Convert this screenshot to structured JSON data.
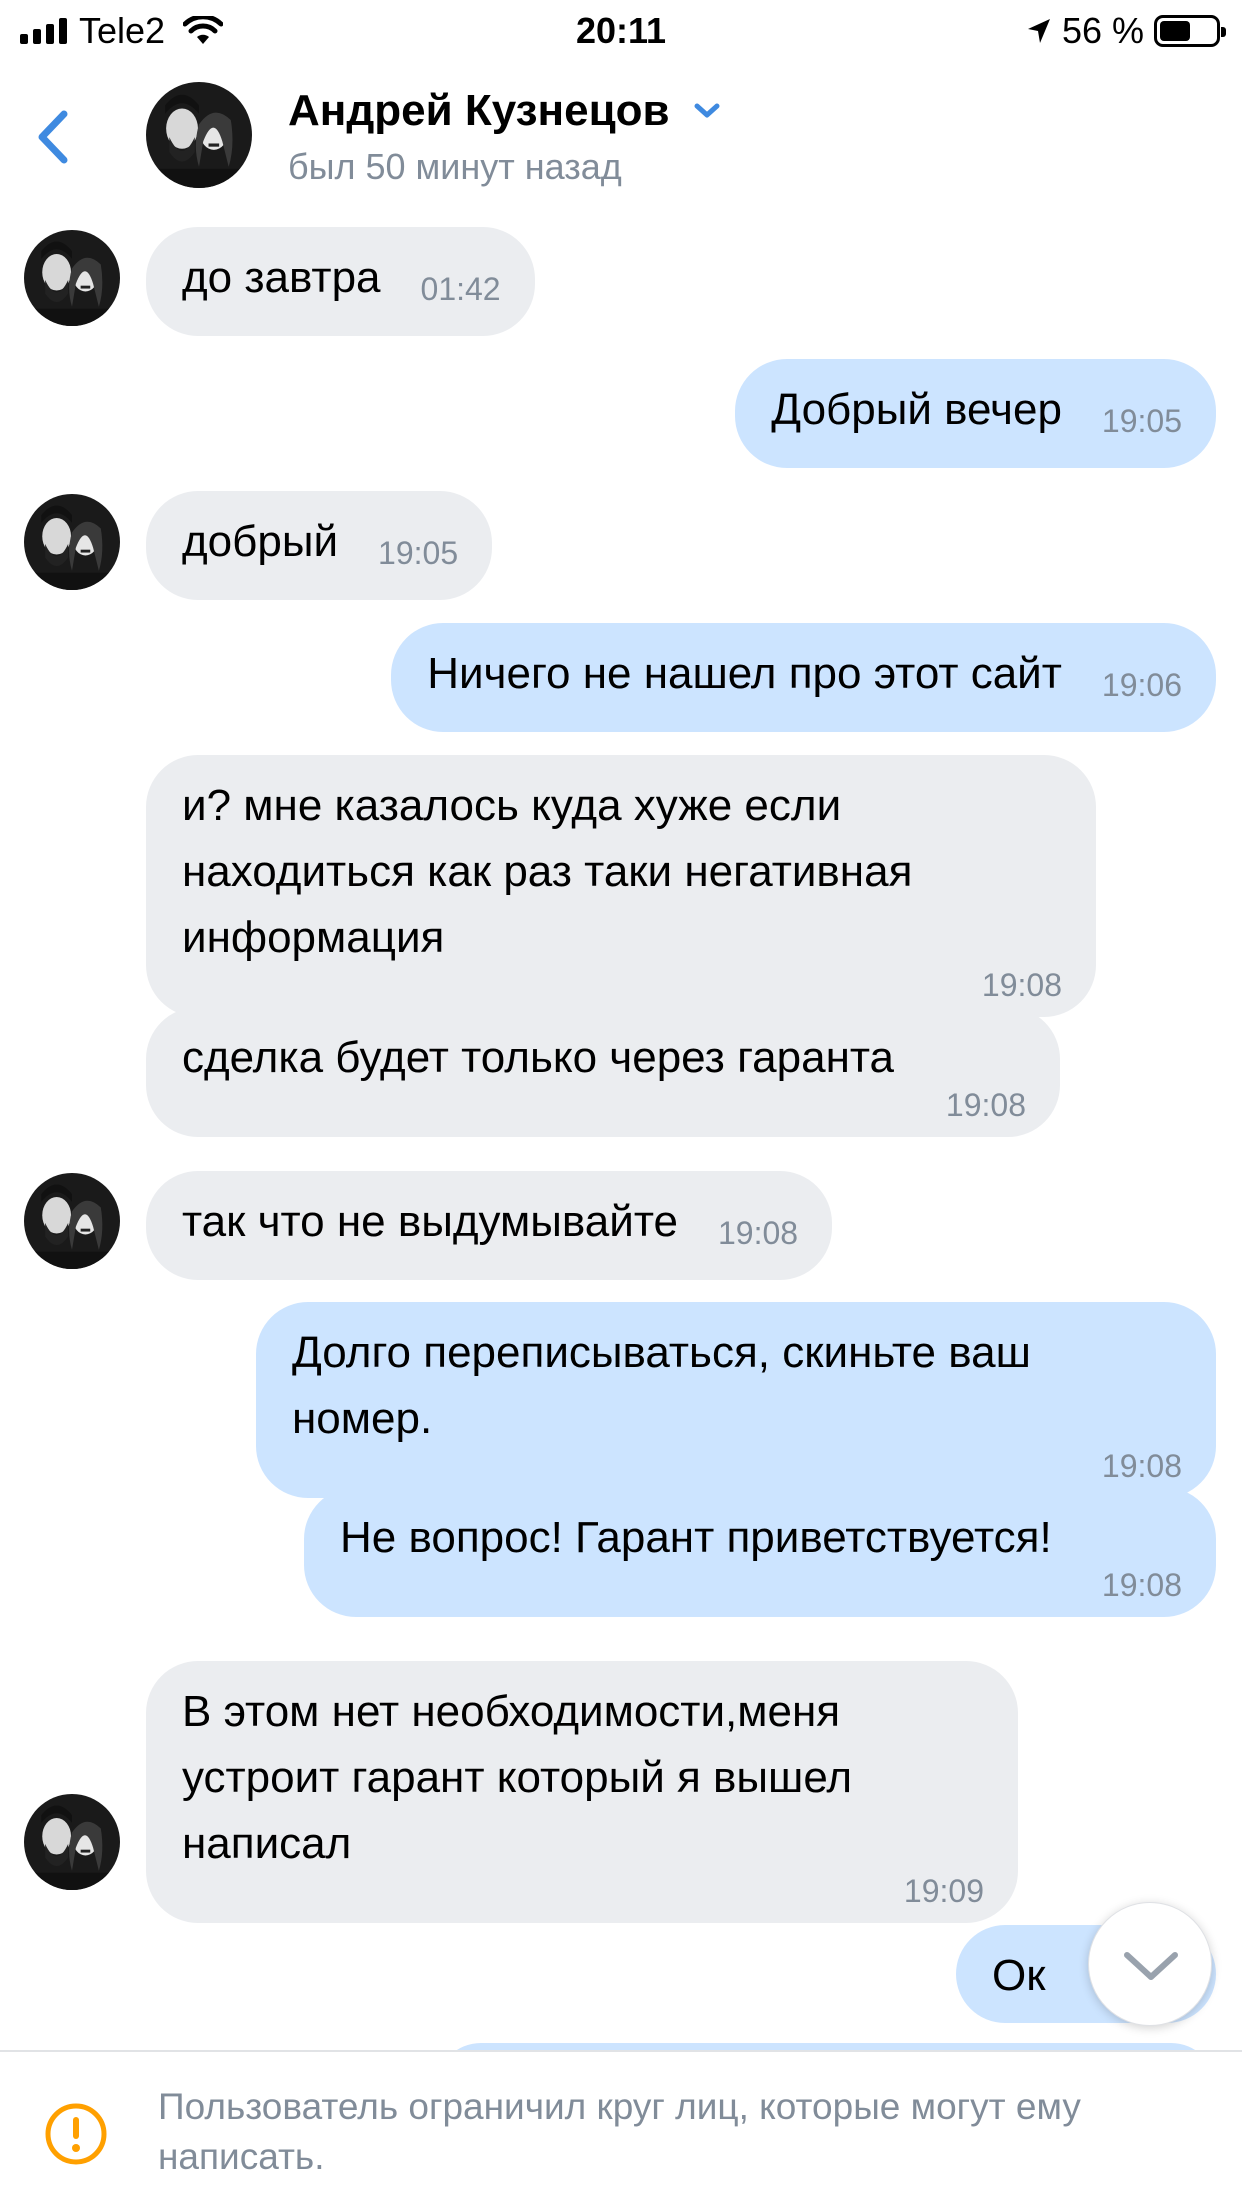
{
  "status_bar": {
    "carrier": "Tele2",
    "time": "20:11",
    "battery": "56 %",
    "battery_level": 0.56
  },
  "header": {
    "contact_name": "Андрей Кузнецов",
    "last_seen": "был 50 минут назад"
  },
  "messages": [
    {
      "dir": "in",
      "text": "до завтра",
      "time": "01:42"
    },
    {
      "dir": "out",
      "text": "Добрый вечер",
      "time": "19:05"
    },
    {
      "dir": "in",
      "text": "добрый",
      "time": "19:05"
    },
    {
      "dir": "out",
      "text": "Ничего не нашел про этот сайт",
      "time": "19:06"
    },
    {
      "dir": "in",
      "text": "и? мне казалось куда хуже если находиться как раз таки негативная информация",
      "time": "19:08"
    },
    {
      "dir": "in",
      "text": "сделка будет только через гаранта",
      "time": "19:08"
    },
    {
      "dir": "in",
      "text": "так что не выдумывайте",
      "time": "19:08"
    },
    {
      "dir": "out",
      "text": "Долго переписываться, скиньте ваш номер.",
      "time": "19:08"
    },
    {
      "dir": "out",
      "text": "Не вопрос! Гарант приветствуется!",
      "time": "19:08"
    },
    {
      "dir": "in",
      "text": "В этом нет необходимости,меня устроит гарант который я вышел написал",
      "time": "19:09"
    },
    {
      "dir": "out",
      "text": "Ок",
      "time": ""
    }
  ],
  "notice": {
    "text": "Пользователь ограничил круг лиц, которые могут ему написать."
  },
  "colors": {
    "incoming_bubble": "#ebedf0",
    "outgoing_bubble": "#cce4ff",
    "accent": "#3f8ae0",
    "secondary_text": "#818c99",
    "warning": "#ffa000"
  },
  "icons": [
    "back-chevron-icon",
    "dropdown-chevron-icon",
    "wifi-icon",
    "location-arrow-icon",
    "battery-icon",
    "scroll-down-icon",
    "warning-icon"
  ]
}
